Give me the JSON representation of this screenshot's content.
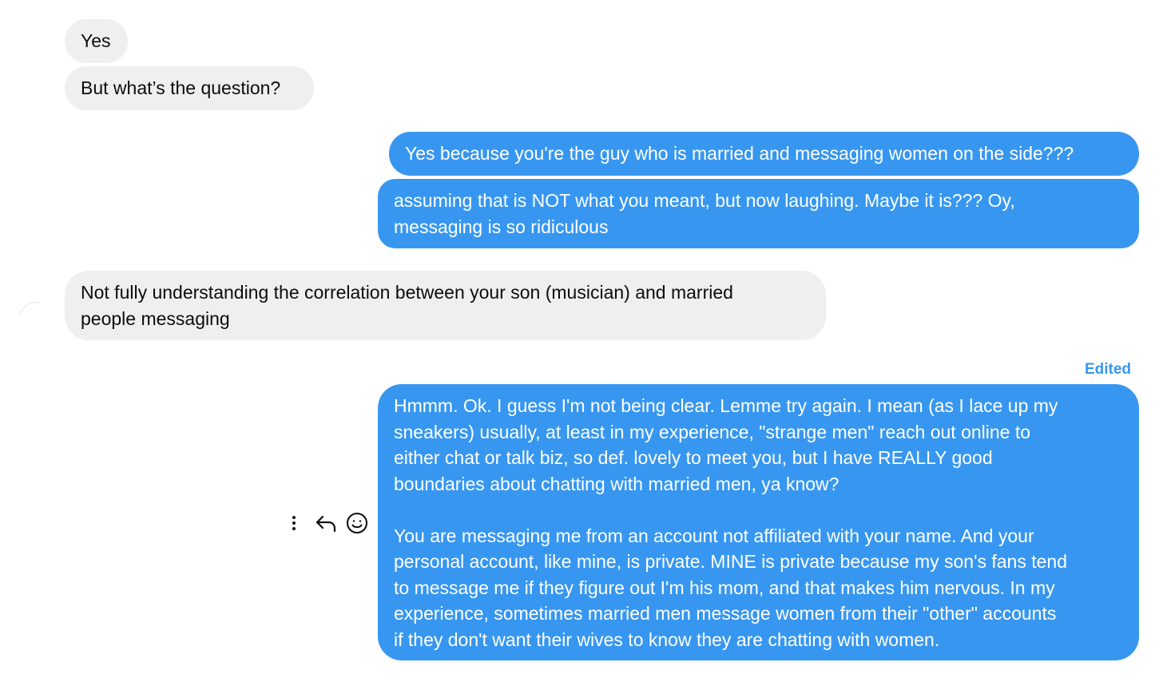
{
  "messages": [
    {
      "direction": "incoming",
      "text": "Yes"
    },
    {
      "direction": "incoming",
      "text": "But what’s the question?"
    },
    {
      "direction": "outgoing",
      "text": "Yes because you're the guy who is married and messaging women on the side???"
    },
    {
      "direction": "outgoing",
      "text": "assuming that is NOT what you meant, but now laughing. Maybe it is??? Oy,\nmessaging is so ridiculous"
    },
    {
      "direction": "incoming",
      "text": "Not fully understanding the correlation between your son (musician) and married\npeople messaging"
    },
    {
      "direction": "outgoing",
      "status": "Edited",
      "text": "Hmmm. Ok. I guess I'm not being clear. Lemme try again. I mean (as I lace up my\nsneakers) usually, at least in my experience, \"strange men\" reach out online to\neither chat or talk biz, so def. lovely to meet you, but I have REALLY good\nboundaries about chatting with married men, ya know?\n\nYou are messaging me from an account not affiliated with your name. And your\npersonal account, like mine, is private. MINE is private because my son's fans tend\nto message me if they figure out I'm his mom, and that makes him nervous. In my\nexperience, sometimes married men message women from their \"other\" accounts\nif they don't want their wives to know they are chatting with women."
    }
  ],
  "message_actions": [
    {
      "icon": "more-options-icon"
    },
    {
      "icon": "reply-icon"
    },
    {
      "icon": "emoji-react-icon"
    }
  ],
  "colors": {
    "outgoing_bubble": "#3797f0",
    "incoming_bubble": "#efefef",
    "incoming_text": "#0c0c0c",
    "edited_label": "#3797f0"
  }
}
